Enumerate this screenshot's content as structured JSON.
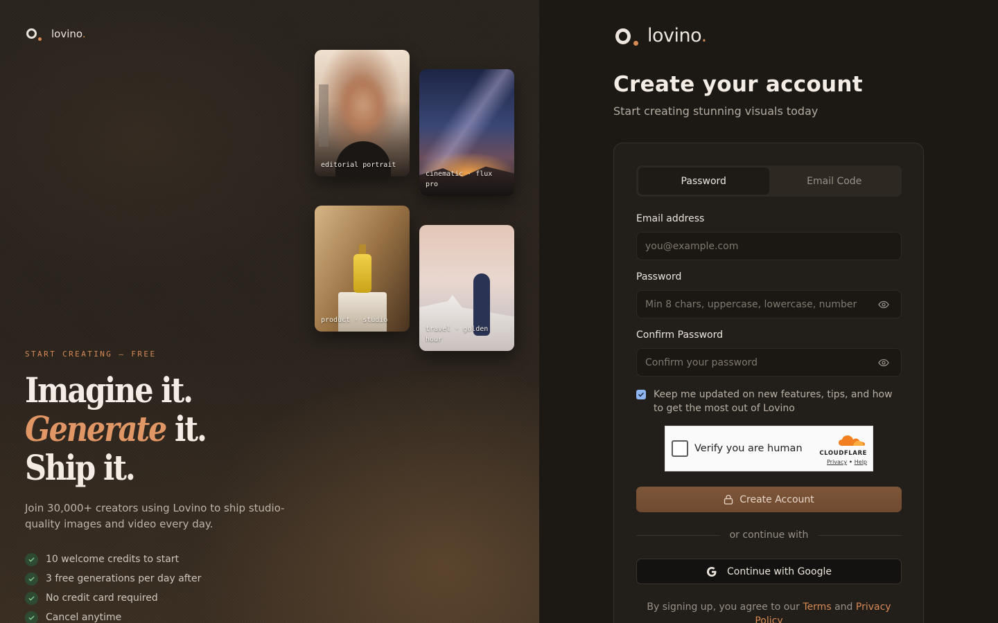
{
  "brand": {
    "name": "lovino",
    "dot": "."
  },
  "hero": {
    "eyebrow": "START CREATING — FREE",
    "headline_line1": "Imagine it.",
    "headline_line2_em": "Generate",
    "headline_line2_rest": " it.",
    "headline_line3": "Ship it.",
    "lead": "Join 30,000+ creators using Lovino to ship studio-quality images and video every day.",
    "benefits": [
      "10 welcome credits to start",
      "3 free generations per day after",
      "No credit card required",
      "Cancel anytime"
    ]
  },
  "gallery": [
    {
      "caption": "editorial portrait"
    },
    {
      "caption": "cinematic · flux pro"
    },
    {
      "caption": "product · studio"
    },
    {
      "caption": "travel · golden hour"
    }
  ],
  "form": {
    "title": "Create your account",
    "subtitle": "Start creating stunning visuals today",
    "tabs": [
      {
        "label": "Password",
        "active": true
      },
      {
        "label": "Email Code",
        "active": false
      }
    ],
    "email": {
      "label": "Email address",
      "placeholder": "you@example.com",
      "value": ""
    },
    "password": {
      "label": "Password",
      "placeholder": "Min 8 chars, uppercase, lowercase, number",
      "value": ""
    },
    "confirm": {
      "label": "Confirm Password",
      "placeholder": "Confirm your password",
      "value": ""
    },
    "optin": {
      "checked": true,
      "text": "Keep me updated on new features, tips, and how to get the most out of Lovino"
    },
    "captcha": {
      "text": "Verify you are human",
      "brand": "CLOUDFLARE",
      "privacy": "Privacy",
      "sep": " • ",
      "help": "Help"
    },
    "submit_label": "Create Account",
    "divider_text": "or continue with",
    "google_label": "Continue with Google",
    "legal": {
      "prefix": "By signing up, you agree to our ",
      "terms": "Terms",
      "and": " and ",
      "privacy": "Privacy Policy"
    }
  },
  "icons": {
    "tab_checkmark": "check-icon",
    "password_toggle": "eye-icon",
    "submit": "lock-icon",
    "google": "google-icon",
    "captcha": "cloudflare-cloud-icon"
  },
  "colors": {
    "accent": "#d78a55",
    "button": "#7a5336",
    "panel": "#221e19",
    "background": "#1c1915"
  }
}
